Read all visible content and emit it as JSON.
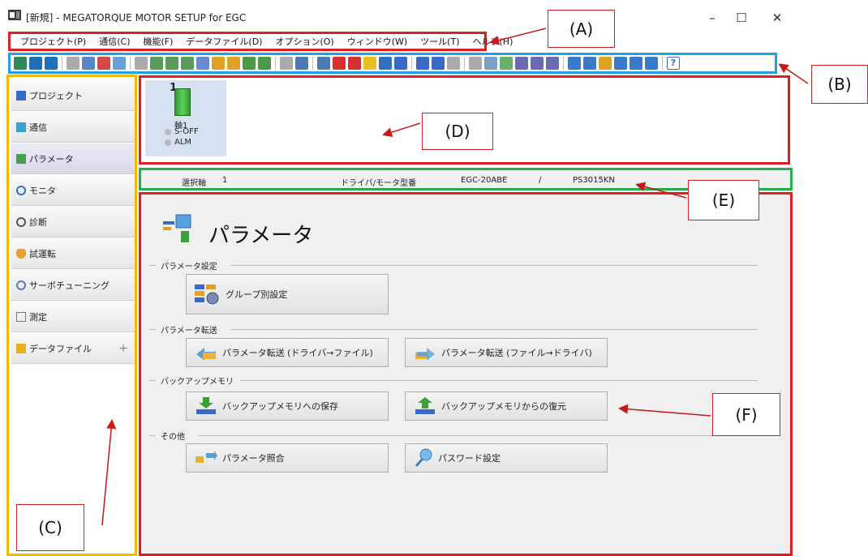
{
  "window": {
    "title": "[新規] - MEGATORQUE MOTOR SETUP for EGC",
    "controls": {
      "minimize": "–",
      "maximize": "☐",
      "close": "✕"
    }
  },
  "menubar": {
    "items": [
      "プロジェクト(P)",
      "通信(C)",
      "機能(F)",
      "データファイル(D)",
      "オプション(O)",
      "ウィンドウ(W)",
      "ツール(T)",
      "ヘルプ(H)"
    ]
  },
  "toolbar": {
    "colors": [
      "#2e8b57",
      "#1f6fb8",
      "#1f6fb8",
      "#aaaaaa",
      "#5b86c8",
      "#d04848",
      "#6aa0d8",
      "#aaaaaa",
      "#5a9a5a",
      "#5a9a5a",
      "#5a9a5a",
      "#6a8ad0",
      "#e0a020",
      "#e0a020",
      "#4a9a4a",
      "#4a9a4a",
      "#aaaaaa",
      "#4a7ab0",
      "#4a7ab0",
      "#d83030",
      "#d83030",
      "#e8c020",
      "#3070c0",
      "#3a6ac8",
      "#3a6ac8",
      "#3a6ac8",
      "#aaaaaa",
      "#aaaaaa",
      "#7aa0c8",
      "#6ab06a",
      "#6a6ab0",
      "#6a6ab0",
      "#6a6ab0",
      "#3a7ac8",
      "#3a7ac8",
      "#e0a020",
      "#3a7ac8",
      "#3a7ac8",
      "#3a7ac8"
    ],
    "help": "?"
  },
  "sidebar": {
    "items": [
      {
        "label": "プロジェクト",
        "icon": "project-icon",
        "color": "#3a6ac8"
      },
      {
        "label": "通信",
        "icon": "communication-icon",
        "color": "#3aa0d0"
      },
      {
        "label": "パラメータ",
        "icon": "parameter-icon",
        "color": "#4aa04a"
      },
      {
        "label": "モニタ",
        "icon": "monitor-icon",
        "color": "#3070c0"
      },
      {
        "label": "診断",
        "icon": "diagnosis-icon",
        "color": "#555555"
      },
      {
        "label": "試運転",
        "icon": "test-run-icon",
        "color": "#e8a030"
      },
      {
        "label": "サーボチューニング",
        "icon": "servo-tuning-icon",
        "color": "#5a7ab0"
      },
      {
        "label": "測定",
        "icon": "measurement-icon",
        "color": "#777777"
      },
      {
        "label": "データファイル",
        "icon": "folder-icon",
        "color": "#e8b020"
      }
    ],
    "plus": "+"
  },
  "axis": {
    "number": "1",
    "name": "軸1",
    "servo_status": "S-OFF",
    "alarm_status": "ALM"
  },
  "infobar": {
    "selected_axis_label": "選択軸",
    "selected_axis_value": "1",
    "model_label": "ドライバ/モータ型番",
    "driver_model": "EGC-20ABE",
    "separator": "/",
    "motor_model": "PS3015KN"
  },
  "main": {
    "title": "パラメータ",
    "sections": [
      {
        "label": "パラメータ設定",
        "buttons": [
          "グループ別設定"
        ]
      },
      {
        "label": "パラメータ転送",
        "buttons": [
          "パラメータ転送 (ドライバ→ファイル)",
          "パラメータ転送 (ファイル→ドライバ)"
        ]
      },
      {
        "label": "バックアップメモリ",
        "buttons": [
          "バックアップメモリへの保存",
          "バックアップメモリからの復元"
        ]
      },
      {
        "label": "その他",
        "buttons": [
          "パラメータ照合",
          "パスワード設定"
        ]
      }
    ]
  },
  "callouts": {
    "a": "(A)",
    "b": "(B)",
    "c": "(C)",
    "d": "(D)",
    "e": "(E)",
    "f": "(F)"
  }
}
